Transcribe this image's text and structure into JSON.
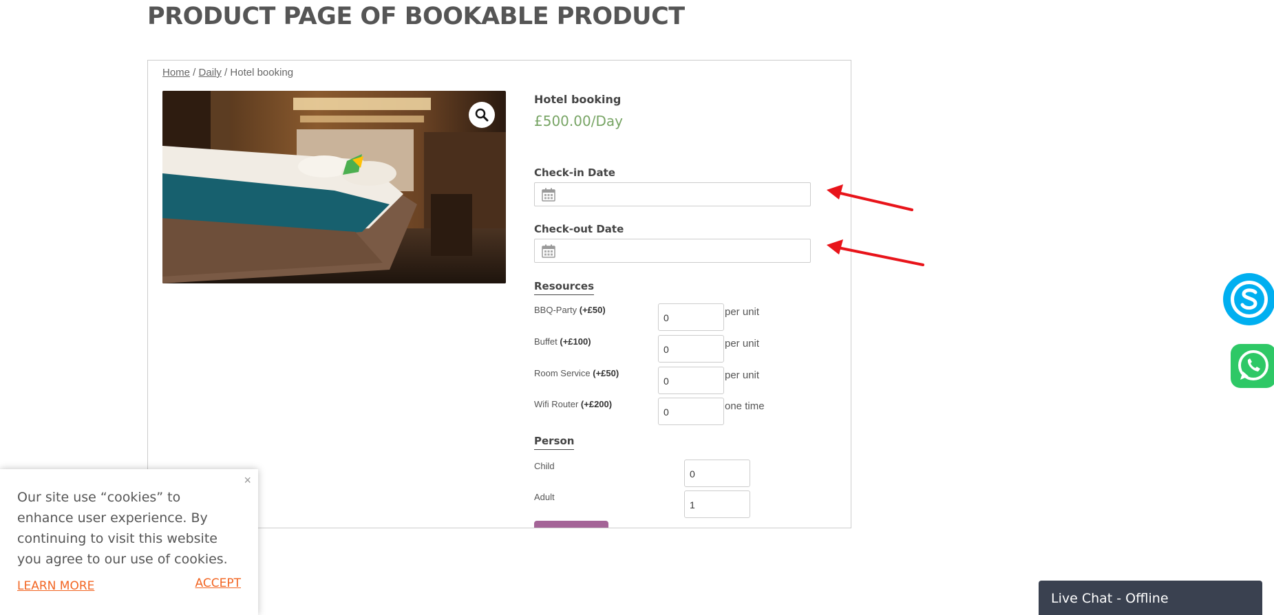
{
  "page_title": "PRODUCT PAGE OF BOOKABLE PRODUCT",
  "breadcrumb": {
    "home": "Home",
    "sep1": " / ",
    "category": "Daily",
    "sep2": " / ",
    "current": "Hotel booking"
  },
  "product": {
    "name": "Hotel booking",
    "price": "£500.00/Day"
  },
  "checkin": {
    "label": "Check-in Date",
    "value": ""
  },
  "checkout": {
    "label": "Check-out Date",
    "value": ""
  },
  "resources": {
    "heading": "Resources",
    "items": [
      {
        "name": "BBQ-Party",
        "price": "(+£50)",
        "value": "0",
        "unit": "per unit"
      },
      {
        "name": "Buffet",
        "price": "(+£100)",
        "value": "0",
        "unit": "per unit"
      },
      {
        "name": "Room Service",
        "price": "(+£50)",
        "value": "0",
        "unit": "per unit"
      },
      {
        "name": "Wifi Router",
        "price": "(+£200)",
        "value": "0",
        "unit": "one time"
      }
    ]
  },
  "person": {
    "heading": "Person",
    "items": [
      {
        "name": "Child",
        "value": "0"
      },
      {
        "name": "Adult",
        "value": "1"
      }
    ]
  },
  "cookie": {
    "text": "Our site use “cookies” to enhance user experience. By continuing to visit this website you agree to our use of cookies.",
    "learn_more": "LEARN MORE",
    "accept": "ACCEPT",
    "close": "×"
  },
  "livechat": {
    "label": "Live Chat - Offline"
  },
  "colors": {
    "price": "#77a464",
    "cookie_link": "#f26522",
    "annotation_arrow": "#e8141a",
    "livechat_bg": "#3a4150"
  },
  "icons": {
    "zoom": "magnifier-icon",
    "calendar": "calendar-icon",
    "skype": "skype-icon",
    "whatsapp": "whatsapp-icon"
  }
}
